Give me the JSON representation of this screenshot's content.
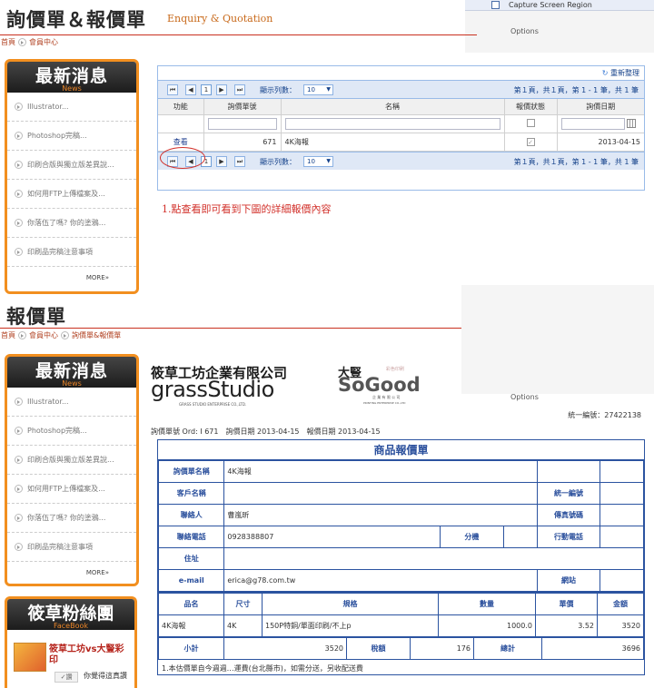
{
  "top_overlay": {
    "capture_label": "Capture Screen Region",
    "options_label": "Options"
  },
  "section1": {
    "title": "詢價單＆報價單",
    "subtitle": "Enquiry & Quotation",
    "breadcrumb": [
      "首頁",
      "會員中心"
    ]
  },
  "news": {
    "title": "最新消息",
    "subtitle": "News",
    "items": [
      "Illustrator...",
      "Photoshop完稿...",
      "印刷合版與獨立版差異說...",
      "如何用FTP上傳檔案及...",
      "你落伍了嗎? 你的塗鴉...",
      "印刷品完稿注意事項"
    ],
    "more": "MORE»"
  },
  "grid": {
    "refresh_label": "重新整理",
    "page_current": "1",
    "page_size_label": "顯示列數：",
    "page_size_value": "10",
    "paging_info": "第１頁，共１頁，第 1 - 1 筆，共 1 筆",
    "columns": [
      "功能",
      "詢價單號",
      "名稱",
      "報價狀態",
      "詢價日期"
    ],
    "row": {
      "action": "查看",
      "id": "671",
      "name": "4K海報",
      "date": "2013-04-15"
    }
  },
  "annotation": "1.點查看即可看到下圖的詳細報價內容",
  "section2": {
    "title": "報價單",
    "breadcrumb": [
      "首頁",
      "會員中心",
      "詢價單&報價單"
    ]
  },
  "company": {
    "name_cn": "筱草工坊企業有限公司",
    "brand": "grassStudio",
    "brand_sub": "GRASS STUDIO ENTERPRISE CO.,LTD.",
    "partner_cn": "大豎",
    "partner_brand": "SoGood",
    "partner_sub_top": "彩色印刷",
    "partner_sub": "企 業 有 限 公 司",
    "partner_sub2": "PRINTING ENTERPRISE CO.,LTD",
    "tax_label": "統一編號：27422138"
  },
  "overlay2": {
    "options_label": "Options"
  },
  "meta_line": "詢價單號 Ord: I 671　詢價日期 2013-04-15　報價日期 2013-04-15",
  "quote": {
    "heading": "商品報價單",
    "labels": {
      "quote_name": "詢價單名稱",
      "customer": "客戶名稱",
      "contact": "聯絡人",
      "phone": "聯絡電話",
      "ext": "分機",
      "mobile": "行動電話",
      "address": "住址",
      "email": "e-mail",
      "tax_id": "統一編號",
      "fax": "傳真號碼",
      "website": "網站"
    },
    "values": {
      "quote_name": "4K海報",
      "contact": "曹嵐昕",
      "phone": "0928388807",
      "email": "erica@g78.com.tw"
    },
    "item_headers": [
      "品名",
      "尺寸",
      "規格",
      "數量",
      "單價",
      "金額"
    ],
    "item": {
      "name": "4K海報",
      "size": "4K",
      "spec": "150P特銅/單面印刷/不上p",
      "qty": "1000.0",
      "price": "3.52",
      "amount": "3520"
    },
    "totals": {
      "subtotal_label": "小計",
      "subtotal": "3520",
      "tax_label": "稅額",
      "tax": "176",
      "total_label": "總計",
      "total": "3696"
    },
    "footer_note": "1.本估價單自今週週…運費(台北縣市)，如需分送，另收配送費"
  },
  "fan": {
    "title": "筱草粉絲團",
    "subtitle": "FaceBook",
    "post_title": "筱草工坊vs大豎彩印",
    "like_label": "讚",
    "comment": "你覺得這真讚"
  }
}
